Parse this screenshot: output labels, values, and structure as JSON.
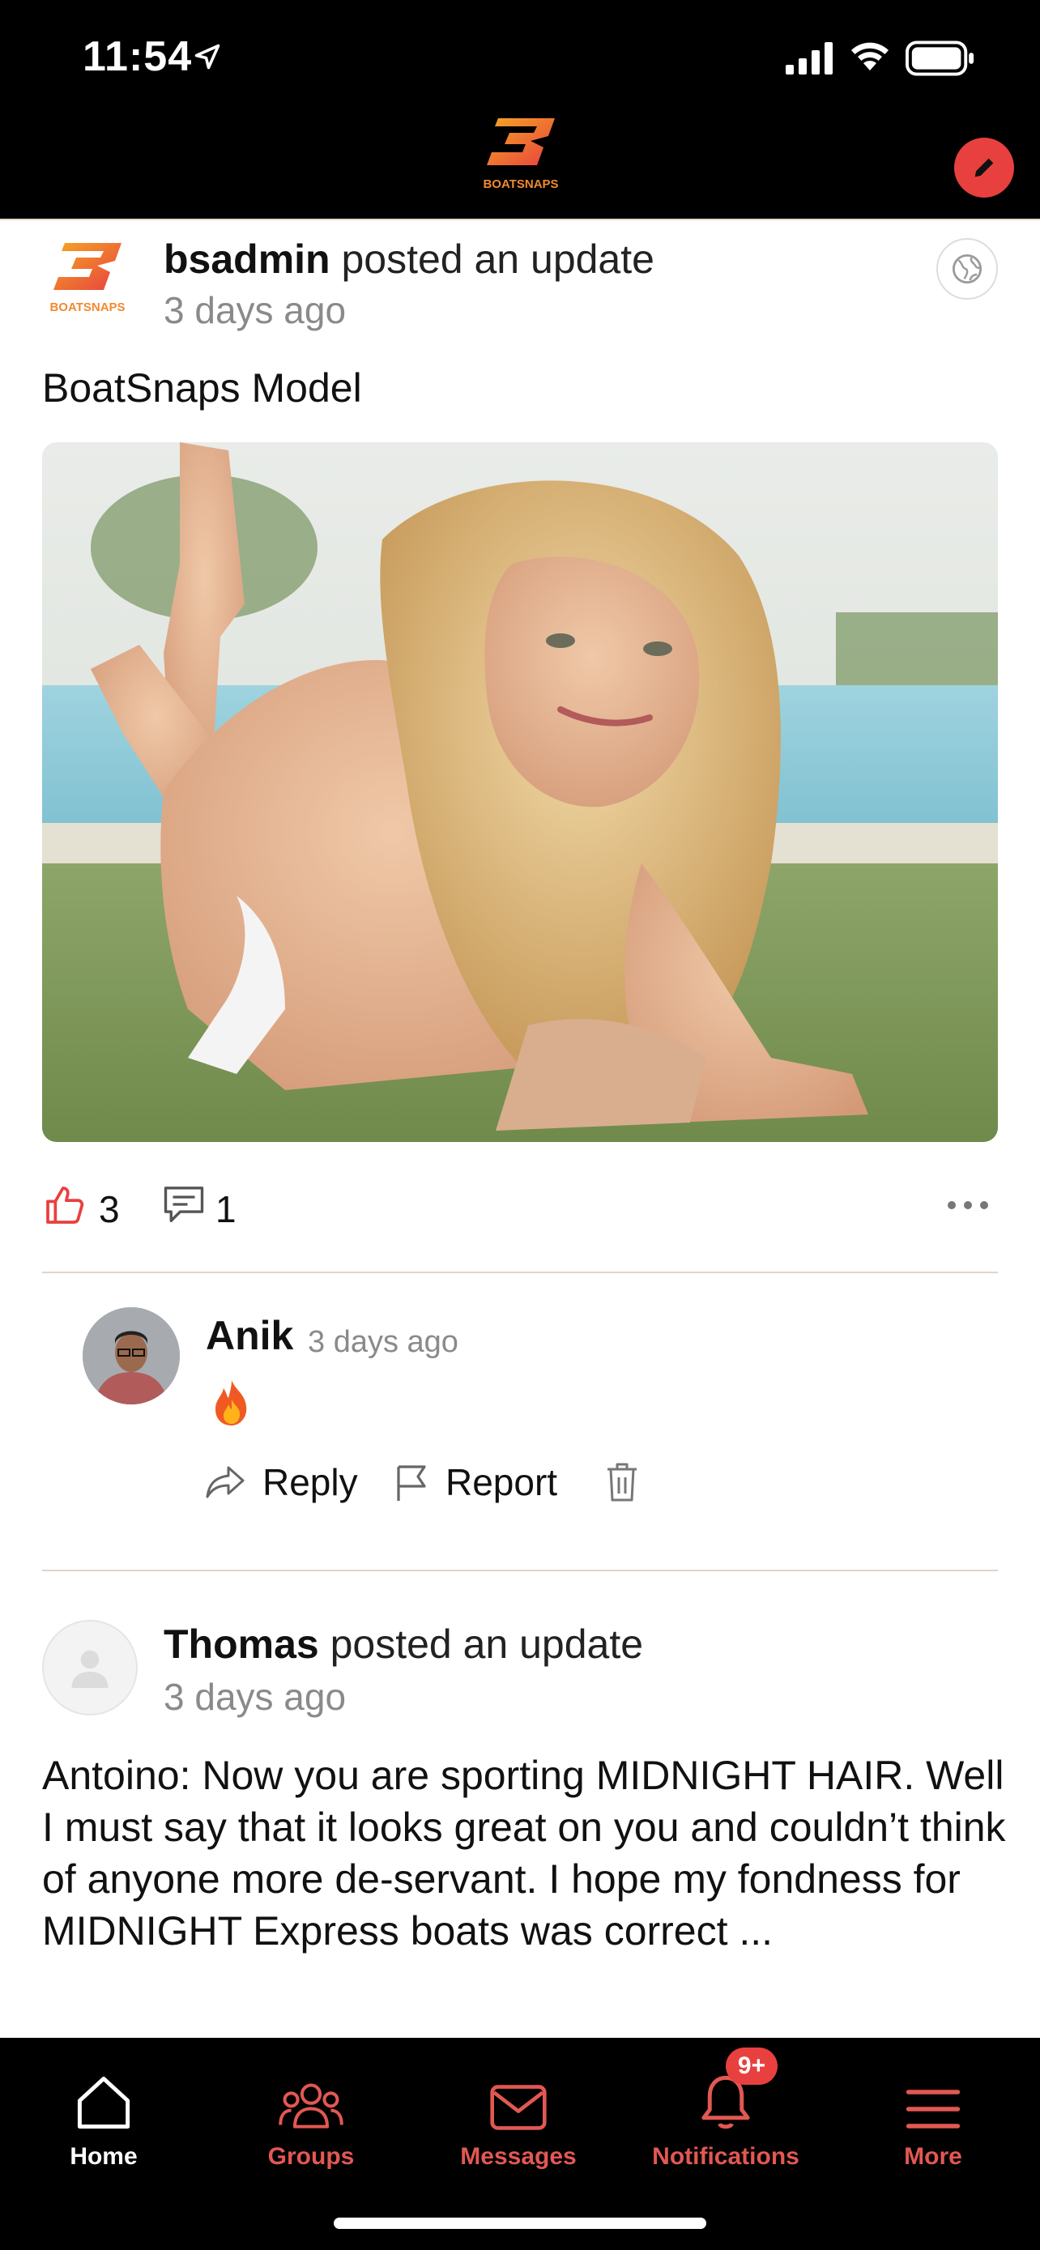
{
  "status_bar": {
    "time": "11:54"
  },
  "header": {
    "logo_text": "BOATSNAPS",
    "compose_icon": "pencil-icon"
  },
  "post1": {
    "author": "bsadmin",
    "action": " posted an update",
    "time": "3 days ago",
    "body": "BoatSnaps Model",
    "likes": "3",
    "comments": "1"
  },
  "comment": {
    "author": "Anik",
    "time": "3 days ago",
    "reply_label": "Reply",
    "report_label": "Report"
  },
  "post2": {
    "author": "Thomas",
    "action": " posted an update",
    "time": "3 days ago",
    "body": "Antoino: Now you are sporting MIDNIGHT HAIR. Well I must say that it looks great on you and couldn’t think of anyone more de-servant. I hope my fondness for MIDNIGHT Express boats was correct ..."
  },
  "tabbar": {
    "home": "Home",
    "groups": "Groups",
    "messages": "Messages",
    "notifications": "Notifications",
    "more": "More",
    "notifications_badge": "9+"
  },
  "colors": {
    "accent": "#e8403f",
    "tab_inactive": "#e25852",
    "divider": "#e3d4c6"
  }
}
